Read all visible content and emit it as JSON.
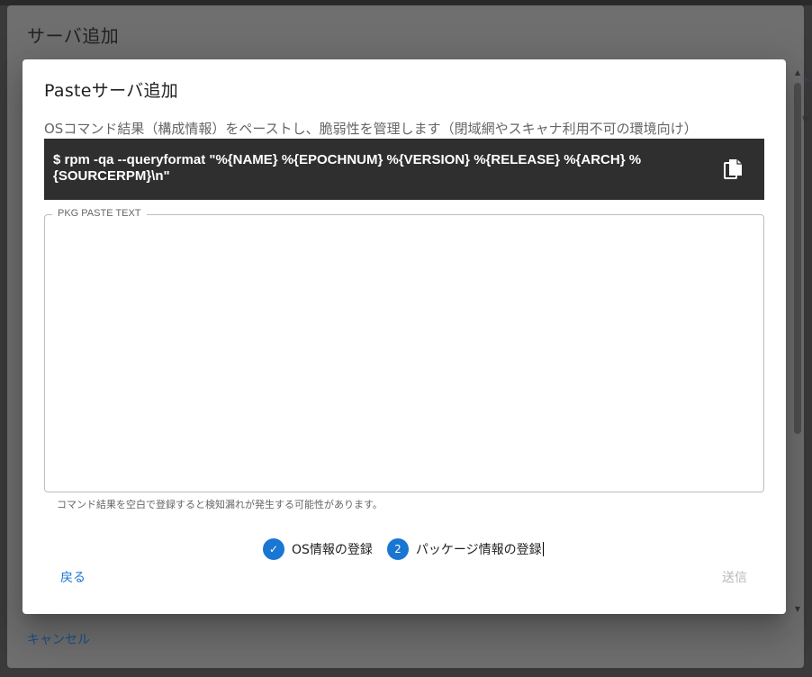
{
  "outer_dialog": {
    "title": "サーバ追加",
    "cancel_label": "キャンセル",
    "hint_text": "ト",
    "hint_text2": "w"
  },
  "dialog": {
    "title": "Pasteサーバ追加",
    "subtitle": "OSコマンド結果（構成情報）をペーストし、脆弱性を管理します（閉域網やスキャナ利用不可の環境向け）",
    "command": "$  rpm -qa --queryformat \"%{NAME} %{EPOCHNUM} %{VERSION} %{RELEASE} %{ARCH} %{SOURCERPM}\\n\"",
    "paste_field": {
      "legend": "PKG PASTE TEXT",
      "value": ""
    },
    "helper_text": "コマンド結果を空白で登録すると検知漏れが発生する可能性があります。",
    "stepper": {
      "steps": [
        {
          "label": "OS情報の登録",
          "marker": "✓",
          "state": "completed"
        },
        {
          "label": "パッケージ情報の登録",
          "marker": "2",
          "state": "active"
        }
      ]
    },
    "back_label": "戻る",
    "submit_label": "送信"
  },
  "colors": {
    "primary": "#1976d2",
    "command_bg": "#2f2f2f",
    "disabled_text": "#b8b8b8"
  }
}
